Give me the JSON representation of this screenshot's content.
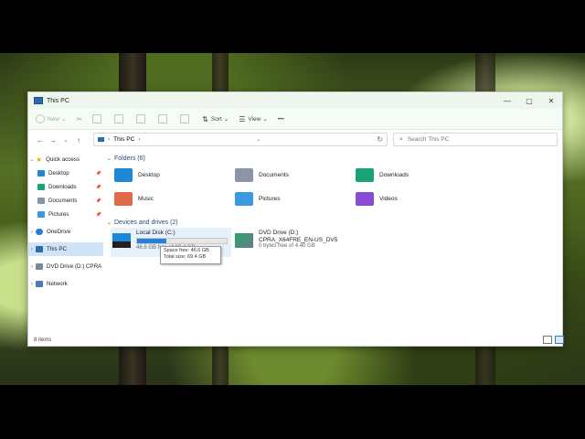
{
  "window": {
    "title": "This PC"
  },
  "toolbar": {
    "new_label": "New",
    "sort_label": "Sort",
    "view_label": "View",
    "more_label": "•••"
  },
  "navbar": {
    "breadcrumb": "This PC",
    "separator": "›",
    "search_placeholder": "Search This PC"
  },
  "sidebar": {
    "quick_access": "Quick access",
    "items": [
      {
        "label": "Desktop"
      },
      {
        "label": "Downloads"
      },
      {
        "label": "Documents"
      },
      {
        "label": "Pictures"
      }
    ],
    "onedrive": "OneDrive",
    "thispc": "This PC",
    "dvd": "DVD Drive (D:) CPRA",
    "network": "Network"
  },
  "folders_section": {
    "label": "Folders (6)"
  },
  "folders": [
    {
      "label": "Desktop",
      "color": "#1e88d6"
    },
    {
      "label": "Documents",
      "color": "#8a96a8"
    },
    {
      "label": "Downloads",
      "color": "#1aa37a"
    },
    {
      "label": "Music",
      "color": "#e06a4a"
    },
    {
      "label": "Pictures",
      "color": "#3a9ae0"
    },
    {
      "label": "Videos",
      "color": "#8a4ad6"
    }
  ],
  "drives_section": {
    "label": "Devices and drives (2)"
  },
  "drives": [
    {
      "name": "Local Disk (C:)",
      "free_text": "46.6 GB free of 69.4 GB",
      "used_fraction": 0.33
    },
    {
      "name": "DVD Drive (D:)",
      "line2": "CPRA_X64FRE_EN-US_DV5",
      "free_text": "0 bytes free of 4.40 GB"
    }
  ],
  "tooltip": {
    "line1": "Space free: 46.6 GB",
    "line2": "Total size: 69.4 GB"
  },
  "status": {
    "items": "8 items"
  }
}
